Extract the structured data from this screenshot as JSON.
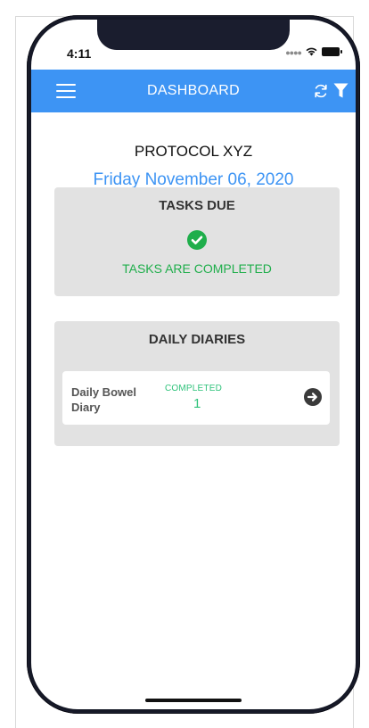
{
  "status_bar": {
    "time": "4:11"
  },
  "header": {
    "title": "DASHBOARD",
    "color": "#3d94f4",
    "icons": [
      "hamburger-menu-icon",
      "refresh-icon",
      "filter-icon"
    ]
  },
  "protocol": {
    "name": "PROTOCOL XYZ",
    "date": "Friday November 06, 2020"
  },
  "tasks_due": {
    "title": "TASKS DUE",
    "status": "TASKS ARE COMPLETED",
    "status_color": "#1fae4b",
    "icon": "check-circle-icon"
  },
  "daily_diaries": {
    "title": "DAILY DIARIES",
    "items": [
      {
        "name": "Daily Bowel Diary",
        "status_label": "COMPLETED",
        "count": "1",
        "icon": "arrow-right-circle-icon"
      }
    ]
  }
}
